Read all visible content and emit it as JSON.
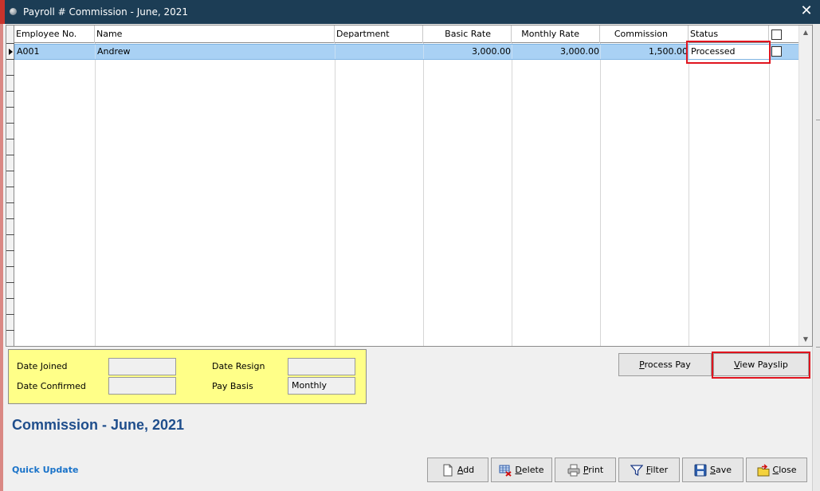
{
  "window": {
    "title": "Payroll # Commission - June, 2021",
    "close_glyph": "✕"
  },
  "grid": {
    "columns": [
      {
        "key": "employee_no",
        "label": "Employee No."
      },
      {
        "key": "name",
        "label": "Name"
      },
      {
        "key": "department",
        "label": "Department"
      },
      {
        "key": "basic_rate",
        "label": "Basic Rate"
      },
      {
        "key": "monthly_rate",
        "label": "Monthly Rate"
      },
      {
        "key": "commission",
        "label": "Commission"
      },
      {
        "key": "status",
        "label": "Status"
      }
    ],
    "rows": [
      {
        "employee_no": "A001",
        "name": "Andrew",
        "department": "",
        "basic_rate": "3,000.00",
        "monthly_rate": "3,000.00",
        "commission": "1,500.00",
        "status": "Processed",
        "selected": false
      }
    ]
  },
  "details": {
    "date_joined_label": "Date Joined",
    "date_joined_value": "",
    "date_confirmed_label": "Date Confirmed",
    "date_confirmed_value": "",
    "date_resign_label": "Date Resign",
    "date_resign_value": "",
    "pay_basis_label": "Pay Basis",
    "pay_basis_value": "Monthly"
  },
  "actions": {
    "process_pay": {
      "prefix": "",
      "key": "P",
      "rest": "rocess Pay"
    },
    "view_payslip": {
      "prefix": "",
      "key": "V",
      "rest": "iew Payslip"
    }
  },
  "heading": "Commission - June, 2021",
  "quick_update": "Quick Update",
  "toolbar": {
    "add": {
      "key": "A",
      "rest": "dd",
      "icon": "document-icon"
    },
    "delete": {
      "key": "D",
      "rest": "elete",
      "icon": "delete-grid-icon"
    },
    "print": {
      "key": "P",
      "rest": "rint",
      "icon": "printer-icon"
    },
    "filter": {
      "key": "F",
      "rest": "ilter",
      "icon": "funnel-icon"
    },
    "save": {
      "key": "S",
      "rest": "ave",
      "icon": "floppy-icon"
    },
    "close": {
      "key": "C",
      "rest": "lose",
      "icon": "folder-close-icon"
    }
  },
  "colors": {
    "titlebar": "#1c3d55",
    "selected_row": "#a9d1f4",
    "panel": "#ffff88",
    "highlight": "#e0141e",
    "heading": "#1f4e8c"
  }
}
